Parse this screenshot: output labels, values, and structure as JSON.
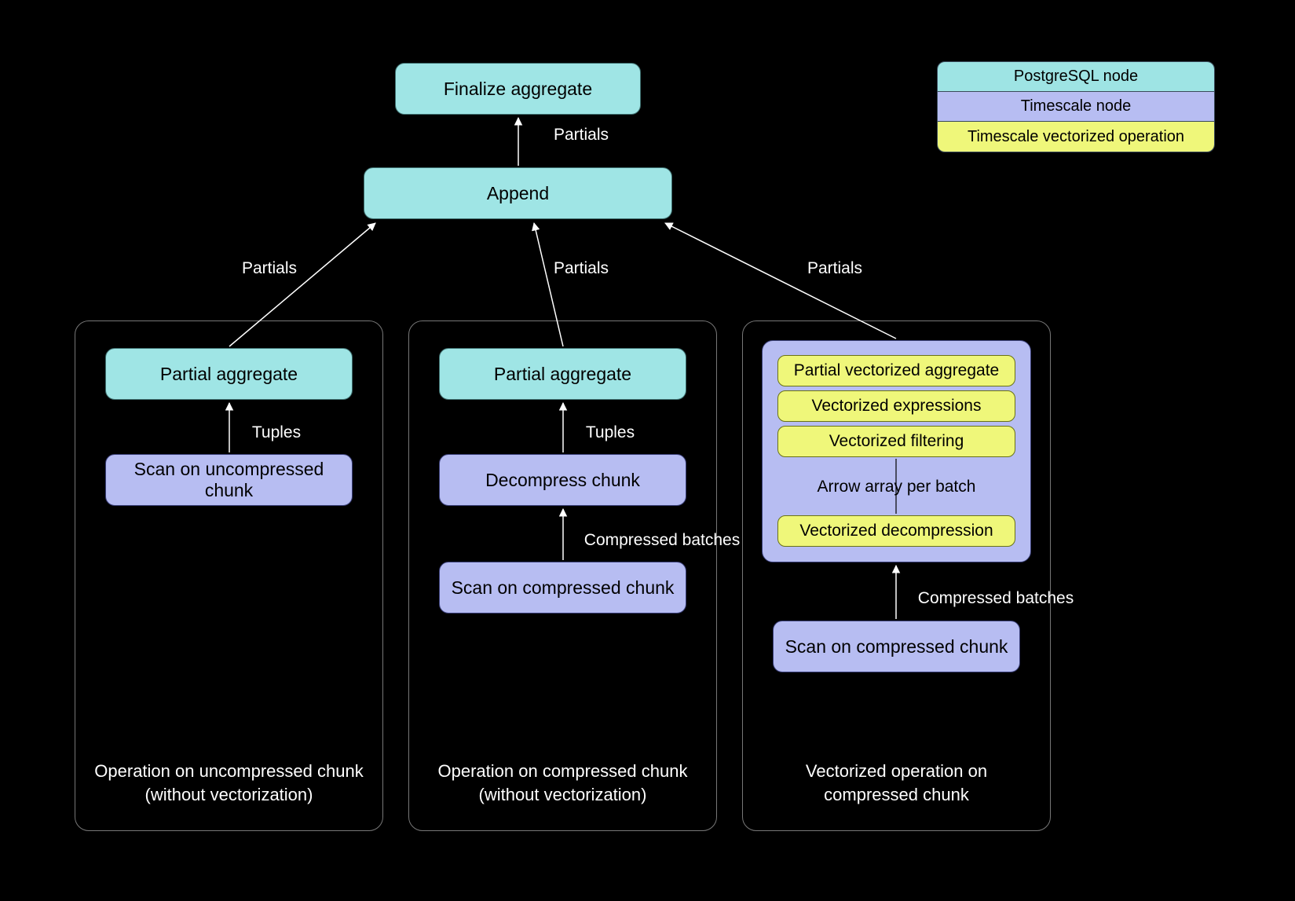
{
  "legend": {
    "pg": "PostgreSQL node",
    "ts": "Timescale node",
    "vec": "Timescale vectorized operation"
  },
  "top": {
    "finalize": "Finalize aggregate",
    "append": "Append",
    "edge_fin_to_append": "Partials",
    "edge_append_to_panels": "Partials"
  },
  "panel1": {
    "caption_l1": "Operation on uncompressed chunk",
    "caption_l2": "(without vectorization)",
    "partial_agg": "Partial aggregate",
    "edge_tuples": "Tuples",
    "scan": "Scan on uncompressed chunk"
  },
  "panel2": {
    "caption_l1": "Operation on compressed chunk",
    "caption_l2": "(without vectorization)",
    "partial_agg": "Partial aggregate",
    "edge_tuples": "Tuples",
    "decompress": "Decompress chunk",
    "edge_batches": "Compressed batches",
    "scan": "Scan on compressed chunk"
  },
  "panel3": {
    "caption_l1": "Vectorized operation on",
    "caption_l2": "compressed chunk",
    "vec_agg": "Partial vectorized aggregate",
    "vec_expr": "Vectorized expressions",
    "vec_filter": "Vectorized filtering",
    "arrow_label": "Arrow array per batch",
    "vec_decomp": "Vectorized decompression",
    "edge_batches": "Compressed batches",
    "scan": "Scan on compressed chunk"
  },
  "colors": {
    "pg": "#9fe5e5",
    "ts": "#b7bdf2",
    "vec": "#eff77a",
    "bg": "#000000"
  }
}
